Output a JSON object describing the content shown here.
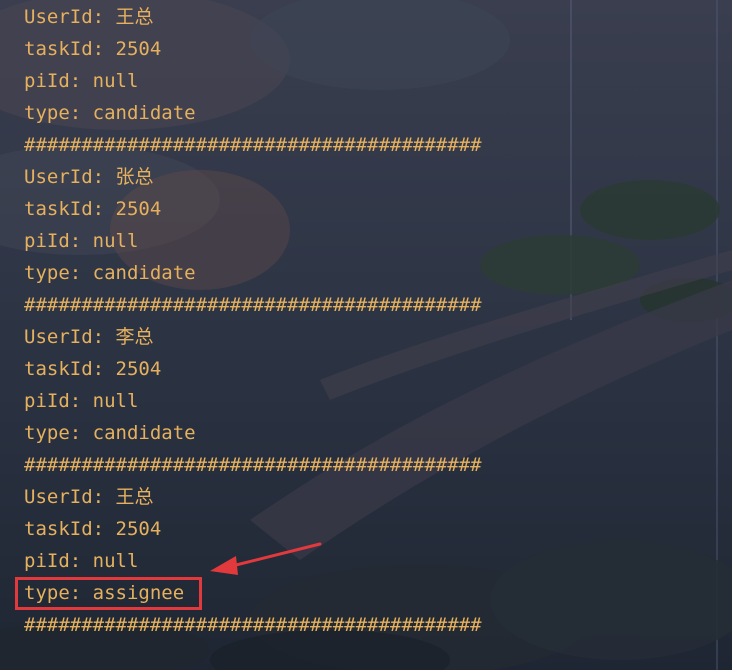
{
  "colors": {
    "text": "#e6b15e",
    "highlight": "#e2393c"
  },
  "console": {
    "lines": [
      {
        "text": "UserId: 王总",
        "kind": "line"
      },
      {
        "text": "taskId: 2504",
        "kind": "line"
      },
      {
        "text": "piId: null",
        "kind": "line"
      },
      {
        "text": "type: candidate",
        "kind": "line"
      },
      {
        "text": "########################################",
        "kind": "separator"
      },
      {
        "text": "UserId: 张总",
        "kind": "line"
      },
      {
        "text": "taskId: 2504",
        "kind": "line"
      },
      {
        "text": "piId: null",
        "kind": "line"
      },
      {
        "text": "type: candidate",
        "kind": "line"
      },
      {
        "text": "########################################",
        "kind": "separator"
      },
      {
        "text": "UserId: 李总",
        "kind": "line"
      },
      {
        "text": "taskId: 2504",
        "kind": "line"
      },
      {
        "text": "piId: null",
        "kind": "line"
      },
      {
        "text": "type: candidate",
        "kind": "line"
      },
      {
        "text": "########################################",
        "kind": "separator"
      },
      {
        "text": "UserId: 王总",
        "kind": "line"
      },
      {
        "text": "taskId: 2504",
        "kind": "line"
      },
      {
        "text": "piId: null",
        "kind": "line"
      },
      {
        "text": "type: assignee",
        "kind": "highlighted"
      },
      {
        "text": "########################################",
        "kind": "separator"
      }
    ]
  },
  "annotation": {
    "arrow_icon": "arrow-left-icon",
    "box": "highlight-box"
  }
}
